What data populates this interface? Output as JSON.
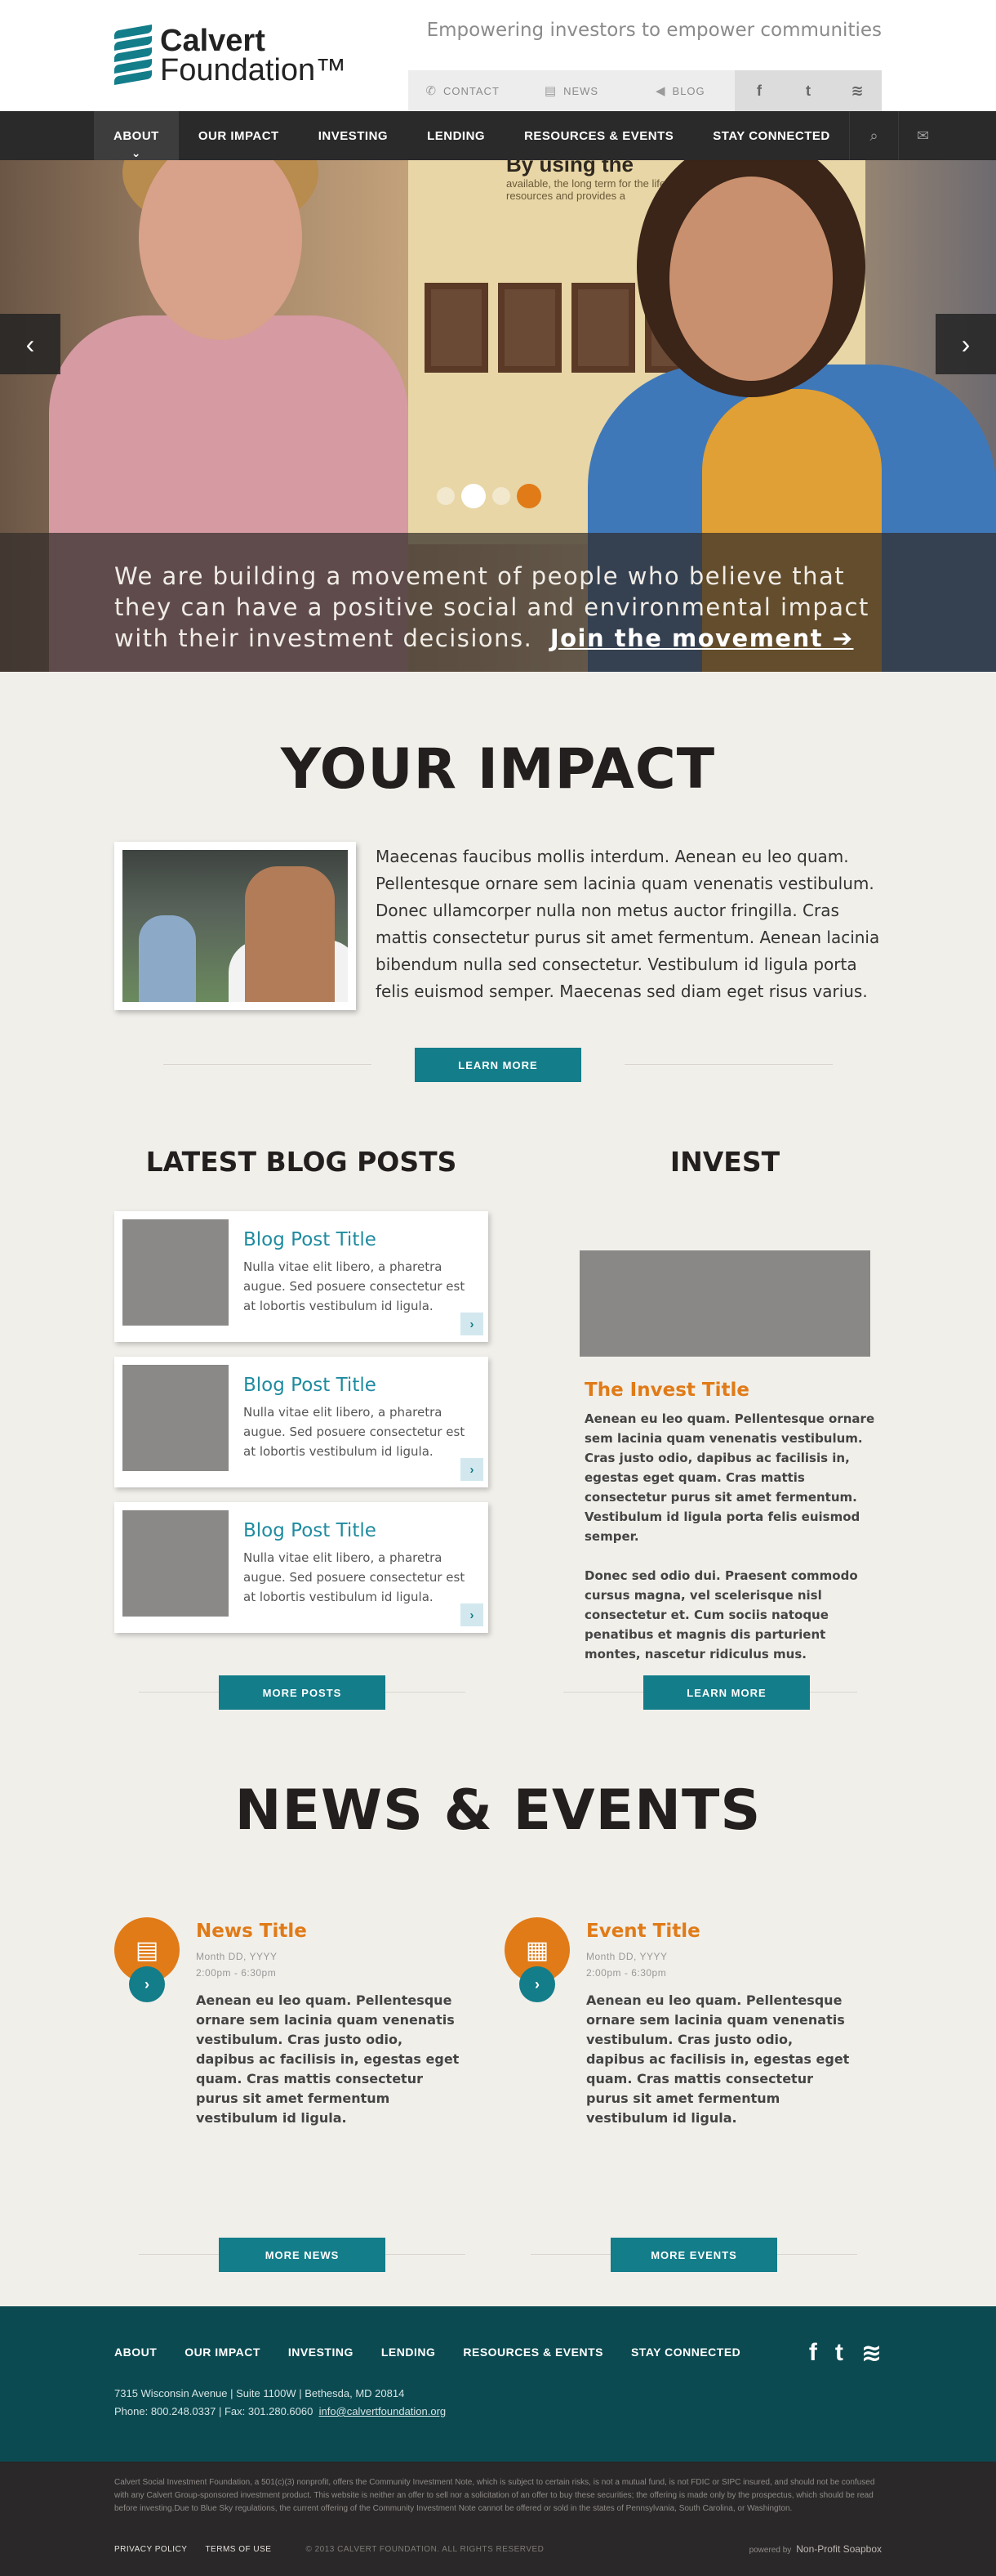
{
  "header": {
    "logo_line1": "Calvert",
    "logo_line2": "Foundation™",
    "tagline": "Empowering investors to empower communities",
    "utility_links": [
      {
        "icon": "phone-icon",
        "label": "CONTACT"
      },
      {
        "icon": "newspaper-icon",
        "label": "NEWS"
      },
      {
        "icon": "megaphone-icon",
        "label": "BLOG"
      }
    ],
    "social": [
      {
        "icon": "facebook-icon",
        "glyph": "f"
      },
      {
        "icon": "twitter-icon",
        "glyph": "t"
      },
      {
        "icon": "rss-icon",
        "glyph": "≋"
      }
    ]
  },
  "nav": {
    "items": [
      "ABOUT",
      "OUR IMPACT",
      "INVESTING",
      "LENDING",
      "RESOURCES & EVENTS",
      "STAY CONNECTED"
    ],
    "active": "ABOUT"
  },
  "hero": {
    "sign_heading": "By using the",
    "sign_text": "available, the long term for the life of your home resources and provides a",
    "caption": "We are building a movement of people who believe that they can have a positive social and environmental impact with their investment decisions.",
    "cta": "Join the movement ➔"
  },
  "impact": {
    "title": "YOUR IMPACT",
    "text": "Maecenas faucibus mollis interdum. Aenean eu leo quam. Pellentesque ornare sem lacinia quam venenatis vestibulum. Donec ullamcorper nulla non metus auctor fringilla. Cras mattis consectetur purus sit amet fermentum. Aenean lacinia bibendum nulla sed consectetur. Vestibulum id ligula porta felis euismod semper. Maecenas sed diam eget risus varius.",
    "button": "LEARN MORE"
  },
  "blog": {
    "title": "LATEST BLOG POSTS",
    "posts": [
      {
        "title": "Blog Post Title",
        "excerpt": "Nulla vitae elit libero, a pharetra augue. Sed posuere consectetur est at lobortis vestibulum id ligula."
      },
      {
        "title": "Blog Post Title",
        "excerpt": "Nulla vitae elit libero, a pharetra augue. Sed posuere consectetur est at lobortis vestibulum id ligula."
      },
      {
        "title": "Blog Post Title",
        "excerpt": "Nulla vitae elit libero, a pharetra augue. Sed posuere consectetur est at lobortis vestibulum id ligula."
      }
    ],
    "button": "MORE POSTS"
  },
  "invest": {
    "title": "INVEST",
    "item_title": "The Invest Title",
    "para1": "Aenean eu leo quam. Pellentesque ornare sem lacinia quam venenatis vestibulum. Cras justo odio, dapibus ac facilisis in, egestas eget quam. Cras mattis consectetur purus sit amet fermentum. Vestibulum id ligula porta felis euismod semper.",
    "para2": "Donec sed odio dui. Praesent commodo cursus magna, vel scelerisque nisl consectetur et. Cum sociis natoque penatibus et magnis dis parturient montes, nascetur ridiculus mus.",
    "button": "LEARN MORE"
  },
  "news_events": {
    "title": "NEWS & EVENTS",
    "news": {
      "title": "News Title",
      "date": "Month DD, YYYY",
      "time": "2:00pm - 6:30pm",
      "text": "Aenean eu leo quam. Pellentesque ornare sem lacinia quam venenatis vestibulum. Cras justo odio, dapibus ac facilisis in, egestas eget quam. Cras mattis consectetur purus sit amet fermentum vestibulum id ligula.",
      "button": "MORE NEWS"
    },
    "event": {
      "title": "Event Title",
      "date": "Month DD, YYYY",
      "time": "2:00pm - 6:30pm",
      "text": "Aenean eu leo quam. Pellentesque ornare sem lacinia quam venenatis vestibulum. Cras justo odio, dapibus ac facilisis in, egestas eget quam. Cras mattis consectetur purus sit amet fermentum vestibulum id ligula.",
      "button": "MORE EVENTS"
    }
  },
  "footer": {
    "nav": [
      "ABOUT",
      "OUR IMPACT",
      "INVESTING",
      "LENDING",
      "RESOURCES & EVENTS",
      "STAY CONNECTED"
    ],
    "address": "7315 Wisconsin Avenue  |  Suite 1100W  |  Bethesda, MD 20814",
    "phone": "Phone: 800.248.0337  |  Fax: 301.280.6060",
    "email": "info@calvertfoundation.org",
    "legal": "Calvert Social Investment Foundation, a 501(c)(3) nonprofit, offers the Community Investment Note, which is subject to certain risks, is not a mutual fund, is not FDIC or SIPC insured, and should not be confused with any Calvert Group-sponsored investment product. This website is neither an offer to sell nor a solicitation of an offer to buy these securities; the offering is made only by the prospectus, which should be read before investing.Due to Blue Sky regulations, the current offering of the Community Investment Note cannot be offered or sold in the states of Pennsylvania, South Carolina, or Washington.",
    "privacy": "PRIVACY POLICY",
    "terms": "TERMS OF USE",
    "copyright": "© 2013 CALVERT FOUNDATION. ALL RIGHTS RESERVED",
    "powered_by": "powered by",
    "powered_name": "Non-Profit Soapbox"
  },
  "colors": {
    "teal": "#137d8a",
    "orange": "#e07b18",
    "footer": "#0b4a51",
    "nav": "#2b2a2a"
  }
}
